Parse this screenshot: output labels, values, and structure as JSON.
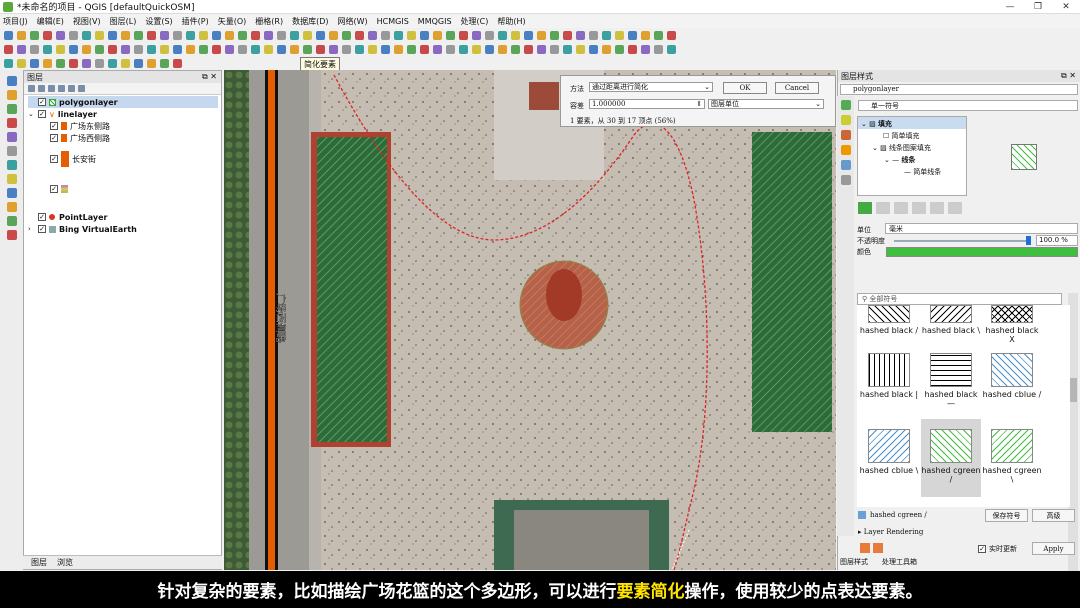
{
  "window": {
    "title": "*未命名的项目 - QGIS [defaultQuickOSM]",
    "controls": [
      "—",
      "❐",
      "✕"
    ]
  },
  "menu": [
    "项目(J)",
    "编辑(E)",
    "视图(V)",
    "图层(L)",
    "设置(S)",
    "插件(P)",
    "矢量(O)",
    "栅格(R)",
    "数据库(D)",
    "网络(W)",
    "HCMGIS",
    "MMQGIS",
    "处理(C)",
    "帮助(H)"
  ],
  "tooltip": "简化要素",
  "layers_panel": {
    "title": "图层",
    "bottom_tabs": [
      "图层",
      "浏览"
    ],
    "items": [
      {
        "label": "polygonlayer",
        "checked": true
      },
      {
        "label": "linelayer",
        "checked": true
      },
      {
        "label": "广场东侧路",
        "checked": true
      },
      {
        "label": "广场西侧路",
        "checked": true
      },
      {
        "label": "长安街",
        "checked": true
      },
      {
        "label": "",
        "checked": true
      },
      {
        "label": "PointLayer",
        "checked": true
      },
      {
        "label": "Bing VirtualEarth",
        "checked": true
      }
    ]
  },
  "map": {
    "road_label": "广场西侧路"
  },
  "dialog": {
    "method_label": "方法",
    "method_value": "通过距离进行简化",
    "tolerance_label": "容差",
    "tolerance_value": "1.000000",
    "unit_value": "图层单位",
    "ok": "OK",
    "cancel": "Cancel",
    "summary": "1 要素，从 30 到 17 顶点 (56%)"
  },
  "style_panel": {
    "title": "图层样式",
    "layer_select": "polygonlayer",
    "renderer": "单一符号",
    "tree": [
      {
        "label": "填充",
        "level": 0
      },
      {
        "label": "简单填充",
        "level": 1
      },
      {
        "label": "线条图案填充",
        "level": 1
      },
      {
        "label": "线条",
        "level": 2
      },
      {
        "label": "简单线条",
        "level": 3
      }
    ],
    "unit_label": "单位",
    "unit_value": "毫米",
    "opacity_label": "不透明度",
    "opacity_value": "100.0 %",
    "opacity_fraction": 1.0,
    "color_label": "颜色",
    "color": "#3fbf3f",
    "search_placeholder": "全部符号",
    "symbols": [
      {
        "name": "hashed black /"
      },
      {
        "name": "hashed black \\"
      },
      {
        "name": "hashed black X"
      },
      {
        "name": "hashed black |"
      },
      {
        "name": "hashed black —"
      },
      {
        "name": "hashed cblue /"
      },
      {
        "name": "hashed cblue \\"
      },
      {
        "name": "hashed cgreen /"
      },
      {
        "name": "hashed cgreen \\"
      }
    ],
    "current_symbol": "hashed cgreen /",
    "save_symbol": "保存符号",
    "advanced": "高级",
    "layer_rendering": "Layer Rendering",
    "realtime_update": "实时更新",
    "apply": "Apply",
    "bottom_tabs": [
      "图层样式",
      "处理工具箱"
    ]
  },
  "caption": {
    "before": "针对复杂的要素，比如描绘广场花篮的这个多边形，可以进行",
    "highlight": "要素简化",
    "after": "操作，使用较少的点表达要素。"
  }
}
